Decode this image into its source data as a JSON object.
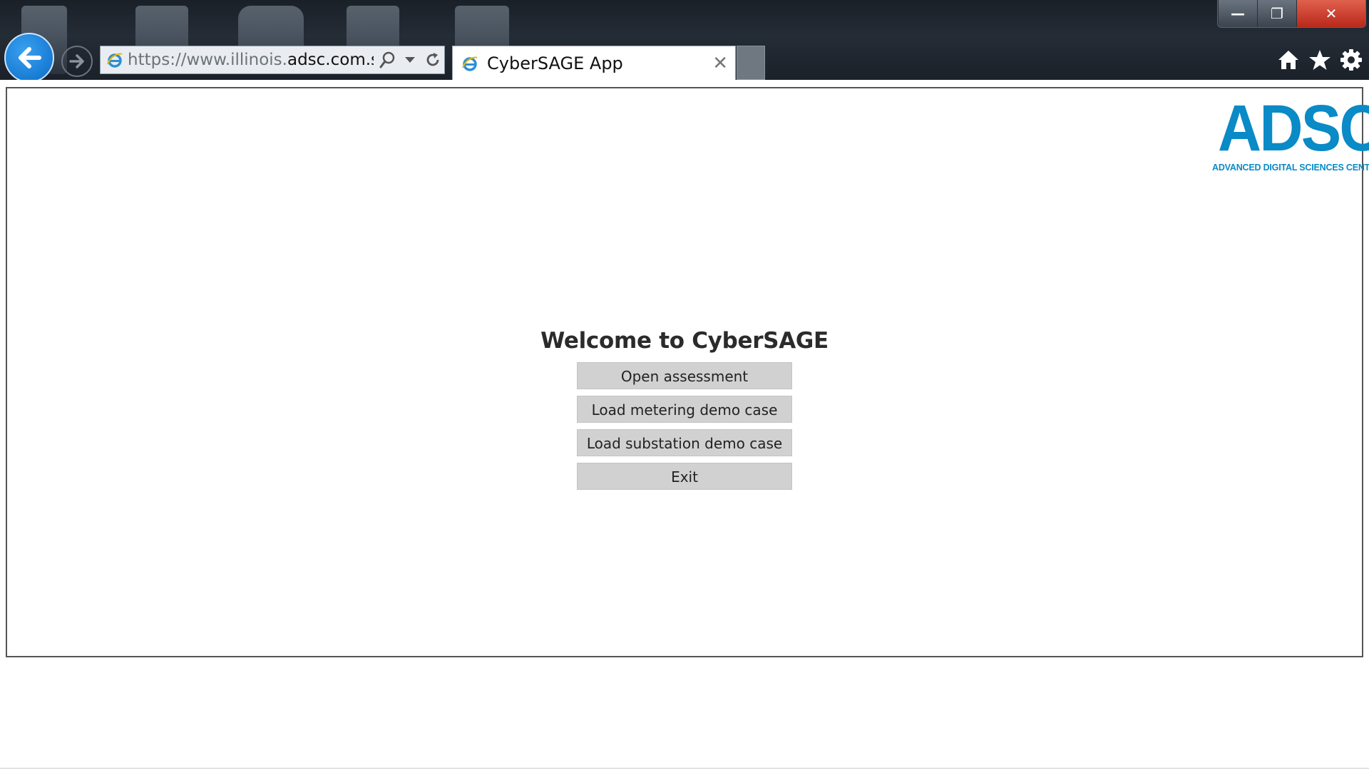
{
  "browser": {
    "address_prefix": "https://www.illinois.",
    "address_domain": "adsc.com.sg",
    "address_suffix": "/",
    "tab_title": "CyberSAGE App",
    "tab_close": "✕",
    "window_controls": {
      "minimize": "—",
      "restore": "❐",
      "close": "✕"
    },
    "icons": [
      "back-arrow-icon",
      "forward-arrow-icon",
      "ie-icon",
      "search-icon",
      "dropdown-icon",
      "refresh-icon",
      "home-icon",
      "star-icon",
      "gear-icon"
    ]
  },
  "logo": {
    "main": "ADSC",
    "sub": "ADVANCED DIGITAL SCIENCES CENTER",
    "color": "#0a8ac6"
  },
  "main": {
    "title": "Welcome to CyberSAGE",
    "buttons": {
      "open": "Open assessment",
      "metering": "Load metering demo case",
      "substation": "Load substation demo case",
      "exit": "Exit"
    }
  }
}
